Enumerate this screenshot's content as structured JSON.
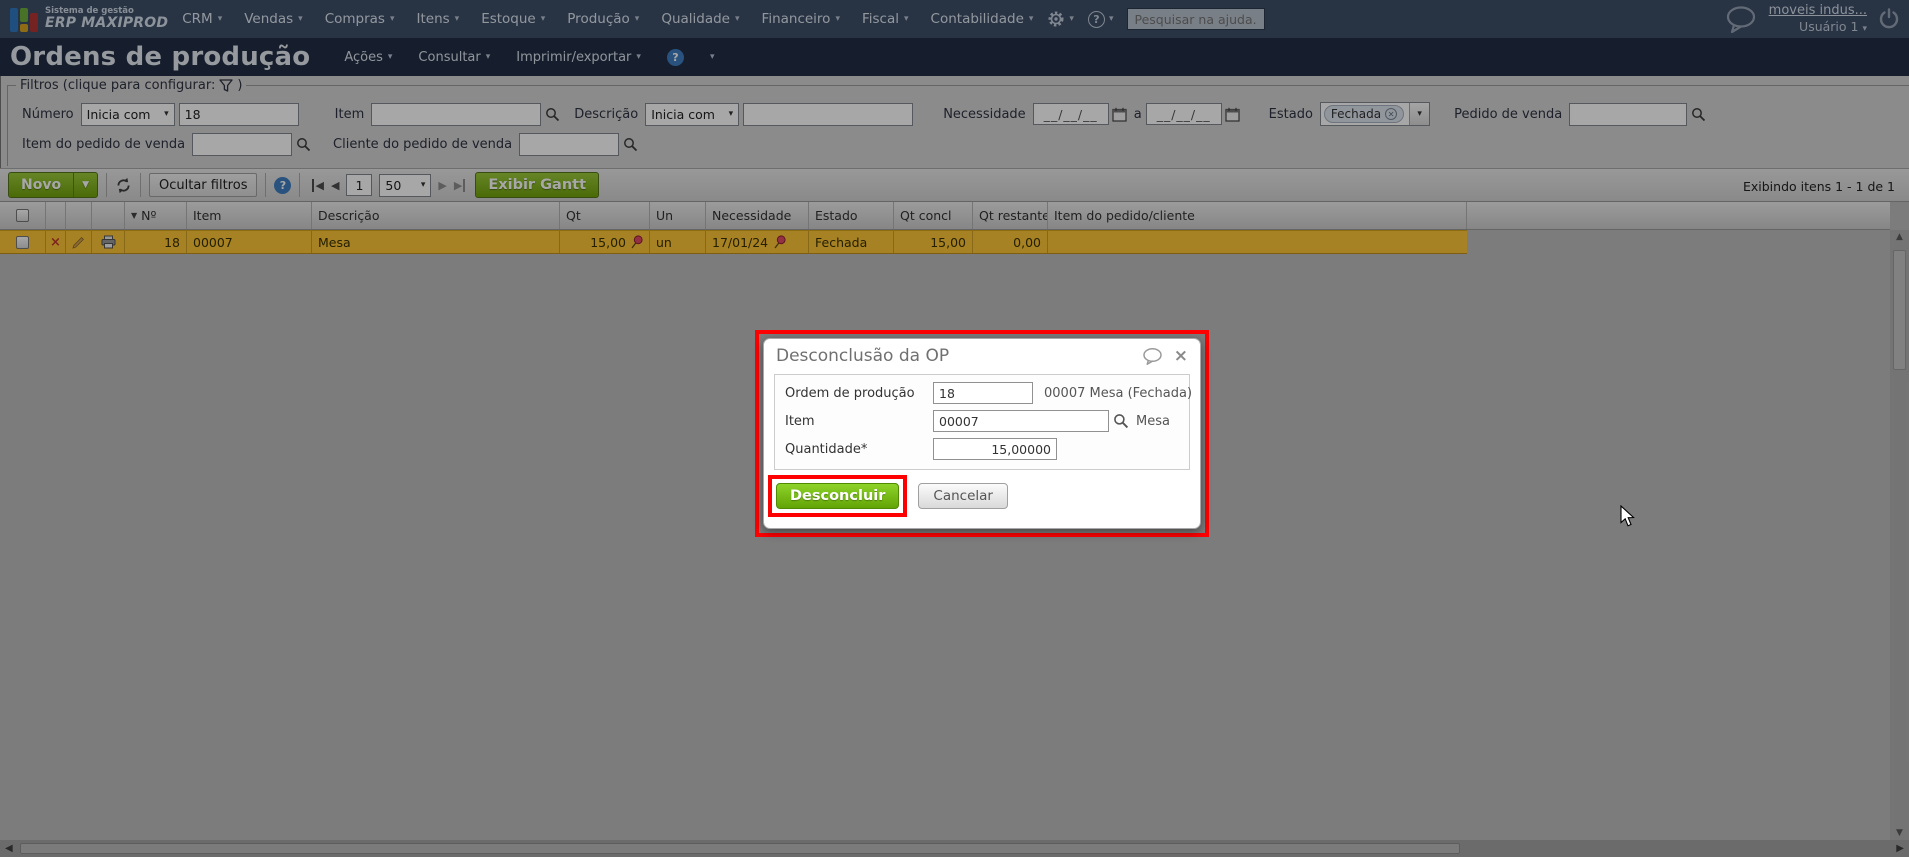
{
  "topbar": {
    "logo_line1": "Sistema de gestão",
    "logo_line2": "ERP MAXIPROD",
    "menus": [
      "CRM",
      "Vendas",
      "Compras",
      "Itens",
      "Estoque",
      "Produção",
      "Qualidade",
      "Financeiro",
      "Fiscal",
      "Contabilidade"
    ],
    "search_placeholder": "Pesquisar na ajuda...",
    "account_link": "moveis indus...",
    "user": "Usuário 1"
  },
  "titlebar": {
    "title": "Ordens de produção",
    "menus": [
      "Ações",
      "Consultar",
      "Imprimir/exportar"
    ]
  },
  "filters": {
    "legend_prefix": "Filtros (clique para configurar:",
    "legend_suffix": ")",
    "numero_label": "Número",
    "numero_op": "Inicia com",
    "numero_value": "18",
    "item_label": "Item",
    "item_value": "",
    "descricao_label": "Descrição",
    "descricao_op": "Inicia com",
    "descricao_value": "",
    "necessidade_label": "Necessidade",
    "date_placeholder": "__/__/__",
    "date_join": "a",
    "estado_label": "Estado",
    "estado_chip": "Fechada",
    "pedido_label": "Pedido de venda",
    "item_pedido_label": "Item do pedido de venda",
    "cliente_pedido_label": "Cliente do pedido de venda"
  },
  "toolbar": {
    "novo_label": "Novo",
    "ocultar_label": "Ocultar filtros",
    "page_value": "1",
    "page_size": "50",
    "gantt_label": "Exibir Gantt",
    "exibindo": "Exibindo itens 1 - 1 de 1"
  },
  "table": {
    "headers": [
      "Nº",
      "Item",
      "Descrição",
      "Qt",
      "Un",
      "Necessidade",
      "Estado",
      "Qt concl",
      "Qt restante",
      "Item do pedido/cliente"
    ],
    "row": {
      "numero": "18",
      "item": "00007",
      "descricao": "Mesa",
      "qt": "15,00",
      "un": "un",
      "necessidade": "17/01/24",
      "estado": "Fechada",
      "qt_concl": "15,00",
      "qt_restante": "0,00",
      "item_pedido": ""
    }
  },
  "dialog": {
    "title": "Desconclusão da OP",
    "fields": [
      {
        "label": "Ordem de produção",
        "value": "18",
        "suffix": "00007 Mesa (Fechada)"
      },
      {
        "label": "Item",
        "value": "00007",
        "suffix": "Mesa"
      },
      {
        "label": "Quantidade*",
        "value": "15,00000",
        "suffix": ""
      }
    ],
    "confirm_label": "Desconcluir",
    "cancel_label": "Cancelar"
  },
  "colors": {
    "accent_green": "#6fa80a",
    "row_highlight": "#fdc738",
    "annotation_red": "#ff0000",
    "topbar_bg": "#3d4f69",
    "titlebar_bg": "#222f45"
  }
}
